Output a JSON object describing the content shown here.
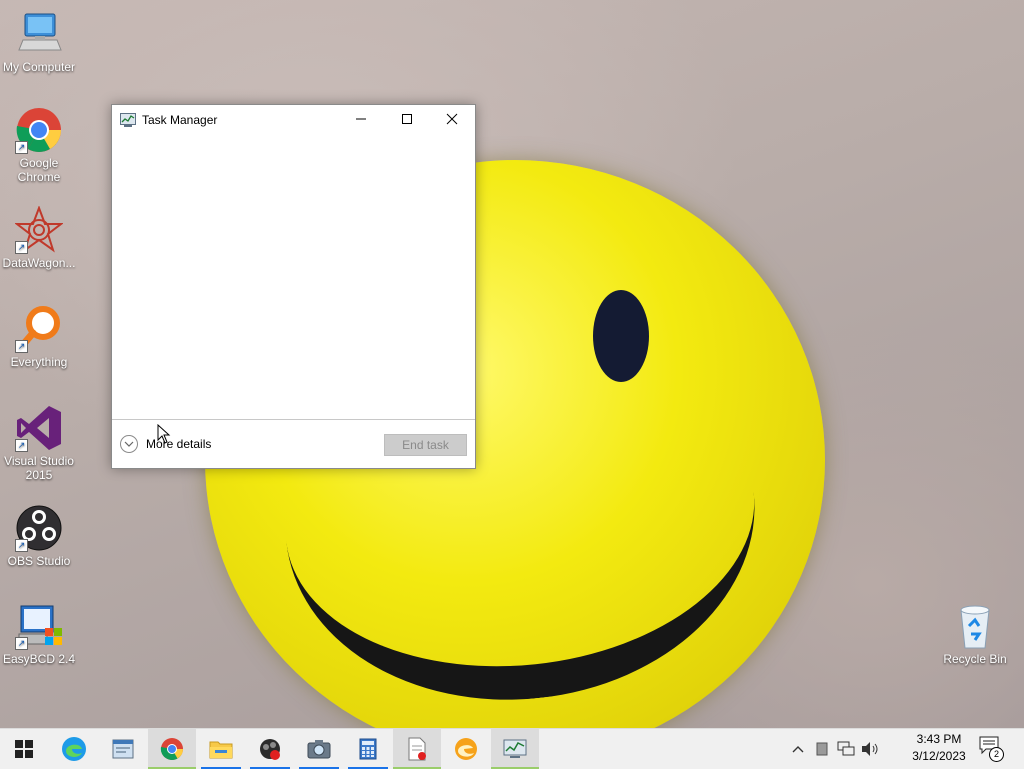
{
  "desktop": {
    "icons": [
      {
        "label": "My Computer",
        "icon": "computer-icon"
      },
      {
        "label": "Google Chrome",
        "icon": "chrome-icon"
      },
      {
        "label": "DataWagon...",
        "icon": "datawagon-icon"
      },
      {
        "label": "Everything",
        "icon": "everything-search-icon"
      },
      {
        "label": "Visual Studio 2015",
        "icon": "visual-studio-icon"
      },
      {
        "label": "OBS Studio",
        "icon": "obs-icon"
      },
      {
        "label": "EasyBCD 2.4",
        "icon": "easybcd-icon"
      },
      {
        "label": "Recycle Bin",
        "icon": "recycle-bin-icon"
      }
    ]
  },
  "task_manager": {
    "title": "Task Manager",
    "more_details": "More details",
    "end_task": "End task"
  },
  "taskbar": {
    "pinned": [
      {
        "name": "start-button",
        "icon": "windows-logo-icon"
      },
      {
        "name": "edge",
        "icon": "edge-icon"
      },
      {
        "name": "control-panel",
        "icon": "window-app-icon"
      },
      {
        "name": "chrome",
        "icon": "chrome-icon"
      },
      {
        "name": "file-explorer",
        "icon": "folder-icon"
      },
      {
        "name": "screen-recorder",
        "icon": "record-icon"
      },
      {
        "name": "camera",
        "icon": "camera-icon"
      },
      {
        "name": "calculator",
        "icon": "calculator-icon"
      },
      {
        "name": "document-viewer",
        "icon": "document-icon"
      },
      {
        "name": "browser",
        "icon": "browser-icon"
      },
      {
        "name": "task-manager",
        "icon": "task-manager-icon"
      }
    ],
    "clock_time": "3:43 PM",
    "clock_date": "3/12/2023",
    "notification_count": "2"
  }
}
